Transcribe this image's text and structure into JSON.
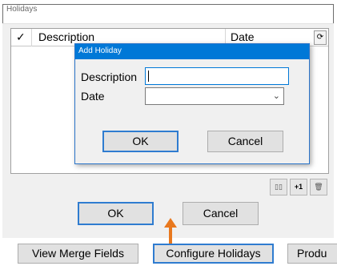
{
  "holidays_window": {
    "title": "Holidays",
    "grid": {
      "columns": [
        {
          "label": "✓"
        },
        {
          "label": "Description"
        },
        {
          "label": "Date"
        }
      ],
      "refresh_glyph": "⟳"
    },
    "grid_buttons": [
      {
        "icon": "calendar-icon",
        "label": "▯▯"
      },
      {
        "icon": "plus-one-icon",
        "label": "+1"
      },
      {
        "icon": "trash-icon",
        "label": "🗑"
      }
    ],
    "ok_label": "OK",
    "cancel_label": "Cancel"
  },
  "add_holiday_dialog": {
    "title": "Add Holiday",
    "description_label": "Description",
    "description_value": "",
    "date_label": "Date",
    "date_value": "",
    "ok_label": "OK",
    "cancel_label": "Cancel"
  },
  "main_toolbar": {
    "buttons": [
      {
        "label": "View Merge Fields"
      },
      {
        "label": "Configure Holidays"
      },
      {
        "label": "Produ"
      }
    ]
  },
  "colors": {
    "accent": "#0078d7",
    "arrow": "#e8781e",
    "dialog_bg": "#f0f0f0"
  }
}
